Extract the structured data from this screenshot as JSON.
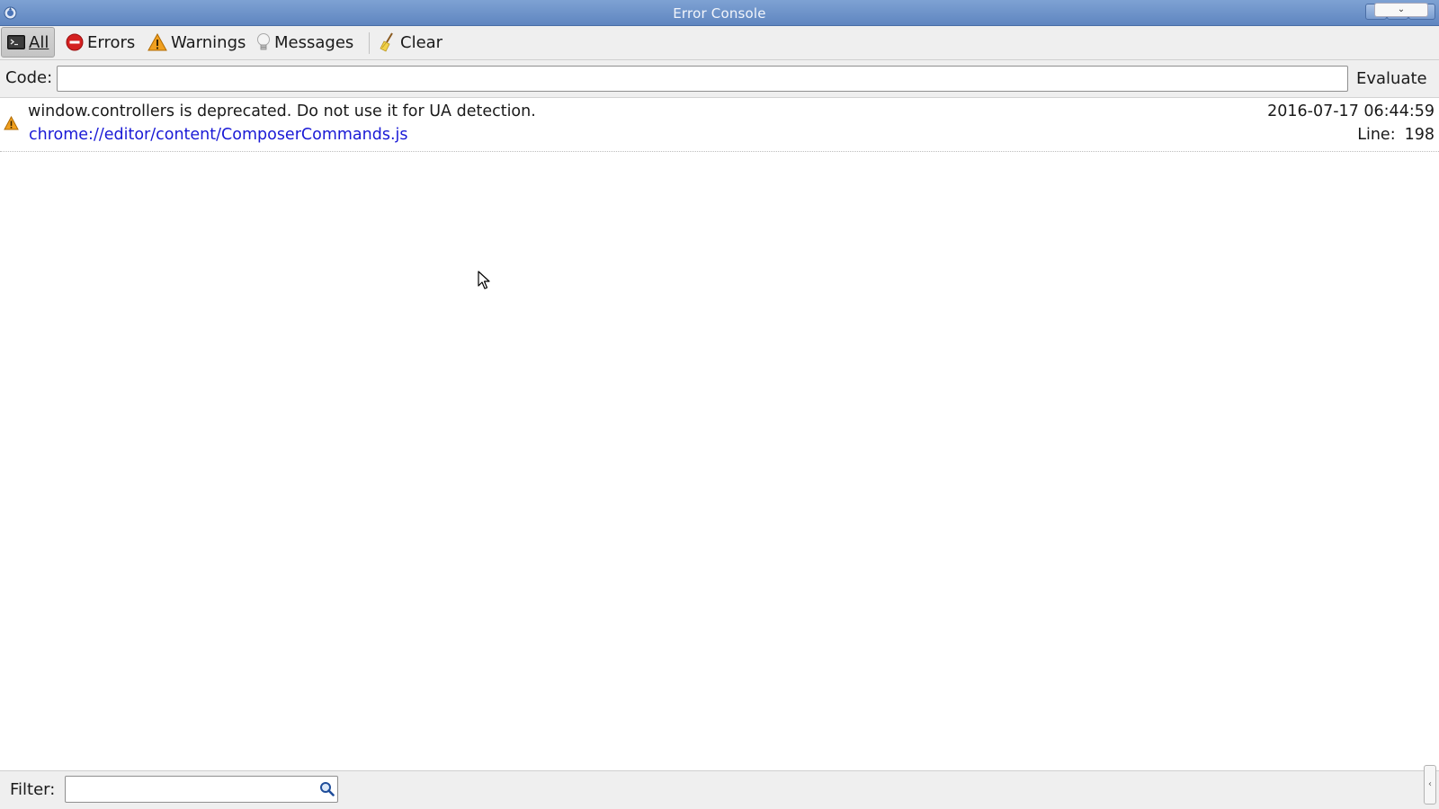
{
  "window": {
    "title": "Error Console"
  },
  "toolbar": {
    "buttons": [
      {
        "id": "all",
        "label": "All",
        "icon": "console-icon",
        "active": true
      },
      {
        "id": "errors",
        "label": "Errors",
        "icon": "error-icon",
        "active": false
      },
      {
        "id": "warnings",
        "label": "Warnings",
        "icon": "warning-icon",
        "active": false
      },
      {
        "id": "messages",
        "label": "Messages",
        "icon": "lightbulb-icon",
        "active": false
      },
      {
        "id": "clear",
        "label": "Clear",
        "icon": "broom-icon",
        "active": false
      }
    ]
  },
  "code": {
    "label": "Code:",
    "value": "",
    "evaluate_label": "Evaluate"
  },
  "messages": [
    {
      "type": "warning",
      "text": "window.controllers is deprecated. Do not use it for UA detection.",
      "source": "chrome://editor/content/ComposerCommands.js",
      "timestamp": "2016-07-17 06:44:59",
      "line_label": "Line:",
      "line": "198"
    }
  ],
  "filter": {
    "label": "Filter:",
    "value": ""
  },
  "colors": {
    "titlebar": "#6a8fc8",
    "link": "#1a1ad6",
    "warning": "#f0a020",
    "error": "#d42020"
  }
}
